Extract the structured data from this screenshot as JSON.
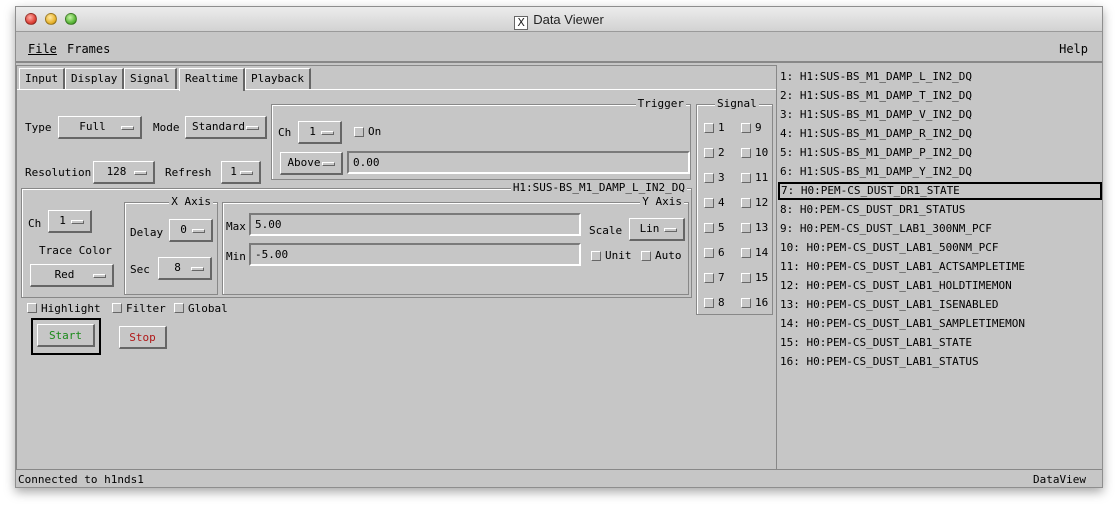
{
  "window": {
    "title": "Data Viewer"
  },
  "menubar": {
    "file": "File",
    "frames": "Frames",
    "help": "Help"
  },
  "tabs": [
    "Input",
    "Display",
    "Signal",
    "Realtime",
    "Playback"
  ],
  "realtime": {
    "type_label": "Type",
    "type_value": "Full",
    "mode_label": "Mode",
    "mode_value": "Standard",
    "resolution_label": "Resolution",
    "resolution_value": "128",
    "refresh_label": "Refresh",
    "refresh_value": "1",
    "trigger": {
      "title": "Trigger",
      "ch_label": "Ch",
      "ch_value": "1",
      "on_label": "On",
      "condition": "Above",
      "level": "0.00"
    },
    "signal_group": {
      "title": "Signal",
      "numbers": [
        "1",
        "9",
        "2",
        "10",
        "3",
        "11",
        "4",
        "12",
        "5",
        "13",
        "6",
        "14",
        "7",
        "15",
        "8",
        "16"
      ]
    },
    "channel_header": "H1:SUS-BS_M1_DAMP_L_IN2_DQ",
    "ch_label": "Ch",
    "ch_value": "1",
    "trace_color_label": "Trace Color",
    "trace_color_value": "Red",
    "xaxis": {
      "title": "X Axis",
      "delay_label": "Delay",
      "delay_value": "0",
      "sec_label": "Sec",
      "sec_value": "8"
    },
    "yaxis": {
      "title": "Y Axis",
      "max_label": "Max",
      "max_value": "5.00",
      "min_label": "Min",
      "min_value": "-5.00",
      "scale_label": "Scale",
      "scale_value": "Lin",
      "unit_label": "Unit",
      "auto_label": "Auto"
    },
    "highlight_label": "Highlight",
    "filter_label": "Filter",
    "global_label": "Global",
    "start_label": "Start",
    "stop_label": "Stop",
    "colors": {
      "start": "#1a8a1a",
      "stop": "#b01818"
    }
  },
  "status": {
    "left": "Connected to h1nds1",
    "right": "DataView"
  },
  "channels": [
    "1: H1:SUS-BS_M1_DAMP_L_IN2_DQ",
    "2: H1:SUS-BS_M1_DAMP_T_IN2_DQ",
    "3: H1:SUS-BS_M1_DAMP_V_IN2_DQ",
    "4: H1:SUS-BS_M1_DAMP_R_IN2_DQ",
    "5: H1:SUS-BS_M1_DAMP_P_IN2_DQ",
    "6: H1:SUS-BS_M1_DAMP_Y_IN2_DQ",
    "7: H0:PEM-CS_DUST_DR1_STATE",
    "8: H0:PEM-CS_DUST_DR1_STATUS",
    "9: H0:PEM-CS_DUST_LAB1_300NM_PCF",
    "10: H0:PEM-CS_DUST_LAB1_500NM_PCF",
    "11: H0:PEM-CS_DUST_LAB1_ACTSAMPLETIME",
    "12: H0:PEM-CS_DUST_LAB1_HOLDTIMEMON",
    "13: H0:PEM-CS_DUST_LAB1_ISENABLED",
    "14: H0:PEM-CS_DUST_LAB1_SAMPLETIMEMON",
    "15: H0:PEM-CS_DUST_LAB1_STATE",
    "16: H0:PEM-CS_DUST_LAB1_STATUS"
  ]
}
